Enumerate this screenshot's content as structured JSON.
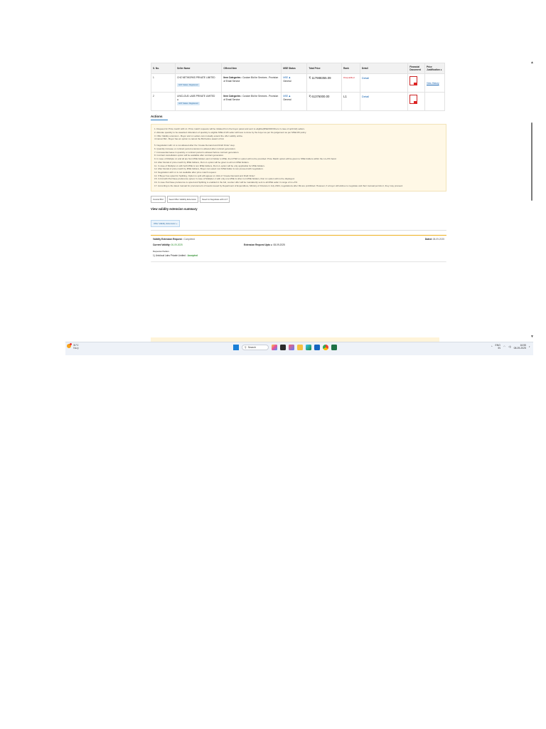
{
  "table": {
    "headers": [
      "S. No.",
      "Seller Name",
      "Offered Item",
      "MSE Status",
      "Total Price",
      "Rank",
      "Detail",
      "Financial Document",
      "Price Justification"
    ],
    "rows": [
      {
        "sno": "1",
        "seller": "CHZ NETWORKS PRIVATE LIMITED",
        "badge": "GST Status: Registered",
        "item_label": "Item Categories :",
        "item_value": "Custom Bid for Services - Provision of Email Service",
        "mse": "MSE",
        "mse_type": "General",
        "price": "₹ 117988355.09",
        "rank": "Disqualified",
        "detail": "Detail",
        "justification": "View History"
      },
      {
        "sno": "2",
        "seller": "UNICLOUD LABS PRIVATE LIMITED",
        "badge": "GST Status: Registered",
        "item_label": "Item Categories :",
        "item_value": "Custom Bid for Services - Provision of Email Service",
        "mse": "MSE",
        "mse_type": "General",
        "price": "₹ 61376000.00",
        "rank": "L1",
        "detail": "Detail",
        "justification": ""
      }
    ]
  },
  "actions": {
    "title": "Actions",
    "notes_a": [
      "1. Request for Price match with L1: Price match requests will be initiated from the buyer panel and sent to eligible(MSE/MII/Others in case of split bid) sellers.",
      "2. Allocate quantity to be awarded: Allocation of quantity to eligible MSE & MII seller will have to done by the buyer as per his judgement as per MSE MII policy.",
      "3. Offer Validity extension - Buyer and L1 sellers can mutually extend the offer validity online.",
      "4.Cancel Bid - Buyer has an option to cancel the Bid before award of bid."
    ],
    "notes_b": [
      "5. Negotiation with L1 is not allowed after the 'Create Demand and Draft Order' step.",
      "6. Quantity increase or contract period extension is allowed after contract generation.",
      "7. Increase/decrease in quantity or contract period is allowed before contract generation.",
      "8. Contract cancellation option will be available after contract generation.",
      "9. In case of Multiple L1 and all are Non MSE bidders and L2 bidder is MSE, then PSM L1 option will not be provided. Price Match option will be given to MSE bidders within the L1+X% band.",
      "10. After Denial of price match by MSE bidders, Run L1 option will be given to all non MSE bidders.",
      "11. In case of Multiple L1 with both MSE & non MSE bidders, Run L1 option will be only applicable for MSE bidders.",
      "12. After Denial of price match by MSE bidders, Buyer can select non MSE bidder & can proceed with negotiation.",
      "13. Negotiation with L1 is not available after price match request.",
      "14. If Buyer has opted for Splitting, Option to split will appear on click of 'Create Demand and Draft Order'.",
      "15. In bid with Purchase preference opted, In case of Multiple L1 with only one MSE & other non MSE bidders, Run L1 option will not be displayed.",
      "16. In case Purchase preference is opted and Splitting is enabled in the bid, counter offer will be mandatorily sent to all MSE seller in range of L1+X%",
      "17. According to the latest manual for procurement of Goods issued by Department of Expenditure, Ministry of Finance in July 2024, negotiations after RA are prohibited. However, if a buyer still wishes to negotiate and their manual permits it, they may proceed."
    ]
  },
  "buttons": {
    "cancel": "Cancel Bid",
    "seek": "Seek Offer Validity Extension",
    "negotiate": "Need to Negotiate with L1?"
  },
  "validity": {
    "title": "View validity extension summary",
    "tab": "Offer Validity Extension »",
    "request_label": "Validity Extension Request :",
    "request_status": "Completed",
    "dated_label": "Dated:",
    "dated": "08-09-2025",
    "current_label": "Current Validity:",
    "current": "06-09-2025",
    "upto_label": "Extension Request Upto",
    "upto": "08-09-2025",
    "requested_label": "Requested Sellers",
    "seller": "1) Unicloud Labs Private Limited :",
    "seller_status": "Accepted"
  },
  "taskbar": {
    "temp": "31°C",
    "weather": "Hazy",
    "search": "Search",
    "lang": "ENG",
    "region": "IN",
    "time": "16:55",
    "date": "08-09-2025"
  }
}
